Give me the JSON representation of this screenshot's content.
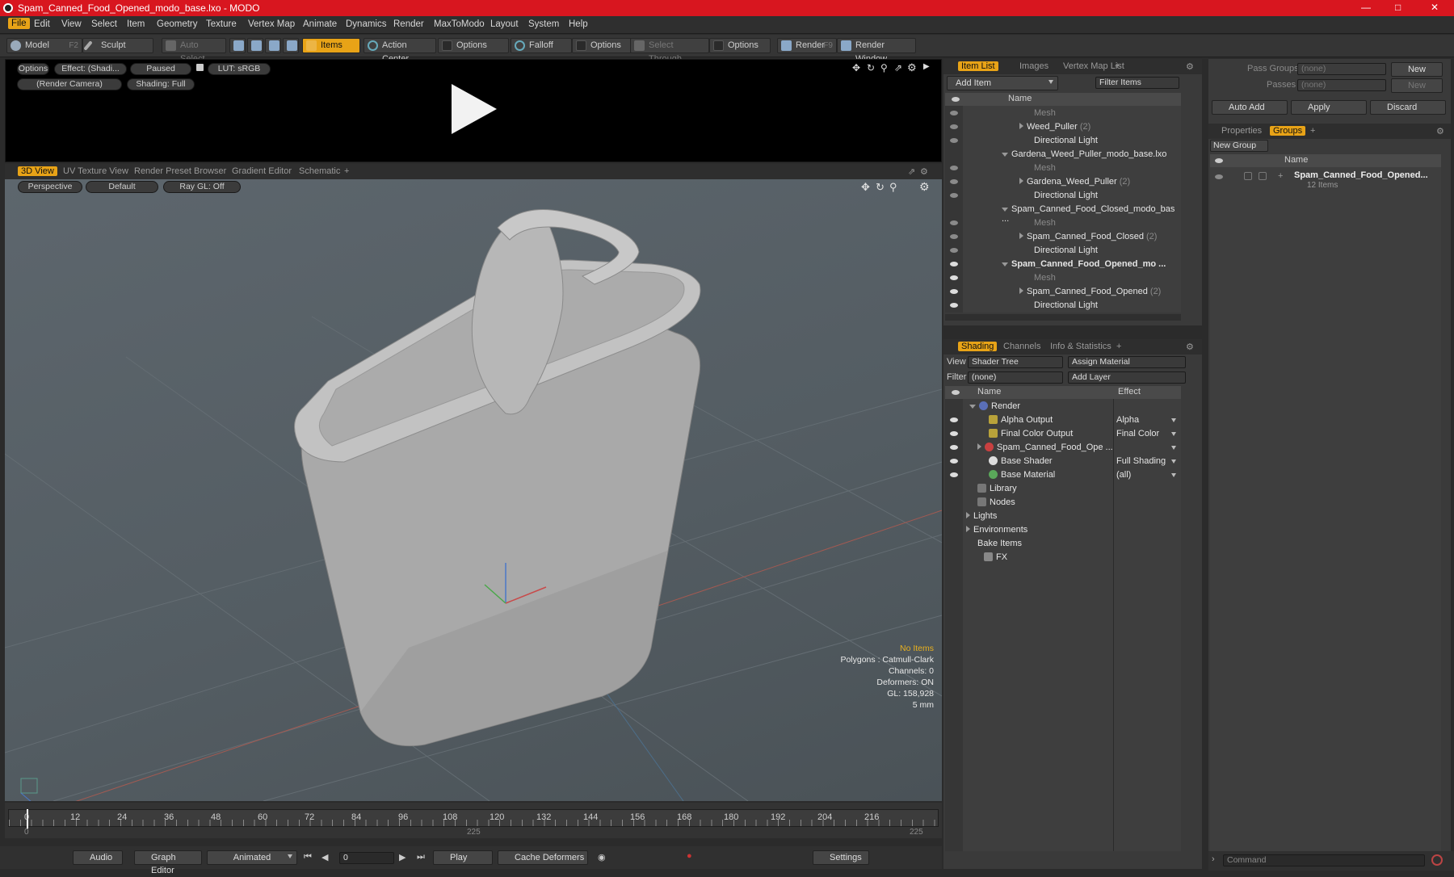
{
  "window": {
    "title": "Spam_Canned_Food_Opened_modo_base.lxo - MODO"
  },
  "menu": [
    "File",
    "Edit",
    "View",
    "Select",
    "Item",
    "Geometry",
    "Texture",
    "Vertex Map",
    "Animate",
    "Dynamics",
    "Render",
    "MaxToModo",
    "Layout",
    "System",
    "Help"
  ],
  "toolbar": {
    "model": "Model",
    "model_key": "F2",
    "sculpt": "Sculpt",
    "auto_select": "Auto Select",
    "items": "Items",
    "action_center": "Action Center",
    "options1": "Options",
    "falloff": "Falloff",
    "options2": "Options",
    "select_through": "Select Through",
    "options3": "Options",
    "render": "Render",
    "render_key": "F9",
    "render_window": "Render Window"
  },
  "preview": {
    "options": "Options",
    "effect": "Effect: (Shadi...",
    "paused": "Paused",
    "lut": "LUT: sRGB",
    "camera": "(Render Camera)",
    "shading": "Shading: Full"
  },
  "viewport_tabs": [
    "3D View",
    "UV Texture View",
    "Render Preset Browser",
    "Gradient Editor",
    "Schematic"
  ],
  "viewport": {
    "perspective": "Perspective",
    "default": "Default",
    "raygl": "Ray GL: Off",
    "stats": {
      "no_items": "No Items",
      "polygons": "Polygons : Catmull-Clark",
      "channels": "Channels: 0",
      "deformers": "Deformers: ON",
      "gl": "GL: 158,928",
      "scale": "5 mm"
    }
  },
  "timeline": {
    "ticks": [
      "0",
      "12",
      "24",
      "36",
      "48",
      "60",
      "72",
      "84",
      "96",
      "108",
      "120",
      "132",
      "144",
      "156",
      "168",
      "180",
      "192",
      "204",
      "216"
    ],
    "start": "0",
    "mid": "225",
    "end": "225"
  },
  "bottombar": {
    "audio": "Audio",
    "graph_editor": "Graph Editor",
    "animated": "Animated",
    "frame": "0",
    "play": "Play",
    "cache": "Cache Deformers",
    "settings": "Settings"
  },
  "item_list": {
    "tabs": [
      "Item List",
      "Images",
      "Vertex Map List"
    ],
    "add_item": "Add Item",
    "filter": "Filter Items",
    "col_name": "Name",
    "rows": [
      {
        "label": "Mesh",
        "kind": "mesh"
      },
      {
        "label": "Weed_Puller",
        "count": "(2)",
        "kind": "group"
      },
      {
        "label": "Directional Light",
        "kind": "light"
      },
      {
        "label": "Gardena_Weed_Puller_modo_base.lxo",
        "kind": "scene"
      },
      {
        "label": "Mesh",
        "kind": "mesh"
      },
      {
        "label": "Gardena_Weed_Puller",
        "count": "(2)",
        "kind": "group"
      },
      {
        "label": "Directional Light",
        "kind": "light"
      },
      {
        "label": "Spam_Canned_Food_Closed_modo_bas ...",
        "kind": "scene"
      },
      {
        "label": "Mesh",
        "kind": "mesh"
      },
      {
        "label": "Spam_Canned_Food_Closed",
        "count": "(2)",
        "kind": "group"
      },
      {
        "label": "Directional Light",
        "kind": "light"
      },
      {
        "label": "Spam_Canned_Food_Opened_mo ...",
        "kind": "scene-bold"
      },
      {
        "label": "Mesh",
        "kind": "mesh"
      },
      {
        "label": "Spam_Canned_Food_Opened",
        "count": "(2)",
        "kind": "group"
      },
      {
        "label": "Directional Light",
        "kind": "light"
      }
    ]
  },
  "shading": {
    "tabs": [
      "Shading",
      "Channels",
      "Info & Statistics"
    ],
    "view_label": "View",
    "view_value": "Shader Tree",
    "assign": "Assign Material",
    "filter_label": "Filter",
    "filter_value": "(none)",
    "add_layer": "Add Layer",
    "col_name": "Name",
    "col_effect": "Effect",
    "rows": [
      {
        "label": "Render",
        "effect": ""
      },
      {
        "label": "Alpha Output",
        "effect": "Alpha"
      },
      {
        "label": "Final Color Output",
        "effect": "Final Color"
      },
      {
        "label": "Spam_Canned_Food_Ope ...",
        "effect": ""
      },
      {
        "label": "Base Shader",
        "effect": "Full Shading"
      },
      {
        "label": "Base Material",
        "effect": "(all)"
      },
      {
        "label": "Library",
        "effect": ""
      },
      {
        "label": "Nodes",
        "effect": ""
      },
      {
        "label": "Lights",
        "effect": ""
      },
      {
        "label": "Environments",
        "effect": ""
      },
      {
        "label": "Bake Items",
        "effect": ""
      },
      {
        "label": "FX",
        "effect": ""
      }
    ]
  },
  "groups": {
    "pass_groups": "Pass Groups",
    "pass_value": "(none)",
    "new": "New",
    "passes": "Passes",
    "passes_value": "(none)",
    "new2": "New",
    "auto_add": "Auto Add",
    "apply": "Apply",
    "discard": "Discard",
    "tabs": [
      "Properties",
      "Groups"
    ],
    "new_group": "New Group",
    "col_name": "Name",
    "item": "Spam_Canned_Food_Opened...",
    "item_count": "12 Items"
  },
  "command": {
    "placeholder": "Command"
  },
  "colors": {
    "accent": "#e8a317",
    "titlebar": "#d8161f"
  }
}
